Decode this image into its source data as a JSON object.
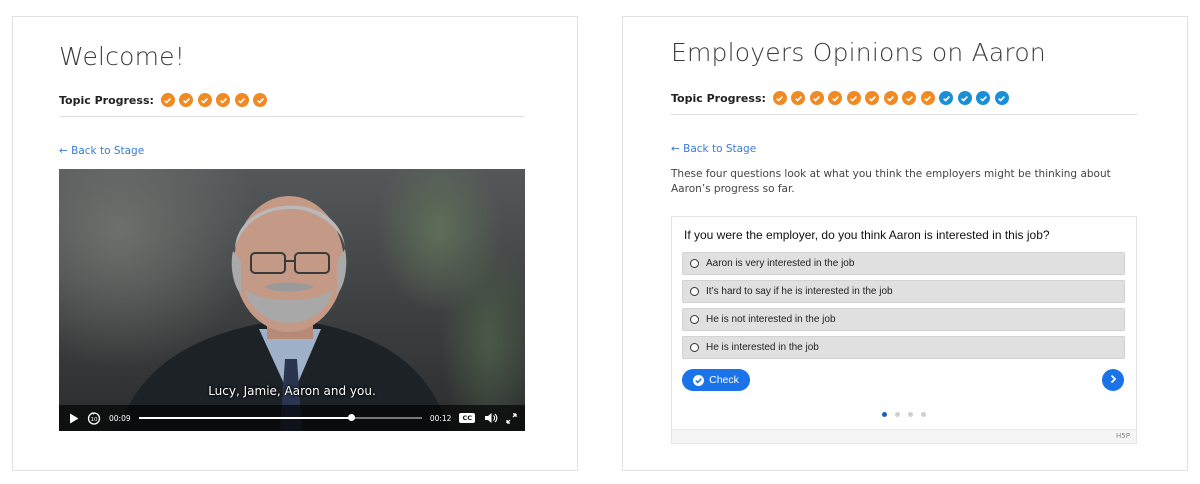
{
  "left_card": {
    "title": "Welcome!",
    "progress_label": "Topic Progress:",
    "progress_items": [
      "complete",
      "complete",
      "complete",
      "complete",
      "complete",
      "complete"
    ],
    "back_link": "← Back to Stage",
    "video": {
      "caption": "Lucy, Jamie, Aaron and you.",
      "current_time": "00:09",
      "duration": "00:12",
      "cc_label": "CC",
      "progress": 0.75
    }
  },
  "right_card": {
    "title": "Employers Opinions on Aaron",
    "progress_label": "Topic Progress:",
    "progress_items": [
      "complete",
      "complete",
      "complete",
      "complete",
      "complete",
      "complete",
      "complete",
      "complete",
      "complete",
      "incomplete",
      "incomplete",
      "incomplete",
      "incomplete"
    ],
    "back_link": "← Back to Stage",
    "intro": "These four questions look at what you think the employers might be thinking about Aaron’s progress so far.",
    "quiz": {
      "question": "If you were the employer, do you think Aaron is interested in this job?",
      "options": [
        "Aaron is very interested in the job",
        "It’s hard to say if he is interested in the job",
        "He is not interested in the job",
        "He is interested in the job"
      ],
      "check_label": "Check",
      "pages": 4,
      "active_page": 1,
      "brand": "H5P"
    }
  },
  "colors": {
    "complete": "#f08a24",
    "incomplete": "#1a8fd6",
    "link": "#3a7bd5",
    "primary_button": "#1a73e8"
  },
  "icons": {
    "progress_item": "checkmark-circle-icon",
    "play": "play-icon",
    "rewind": "rewind-10-icon",
    "volume": "volume-icon",
    "fullscreen": "fullscreen-icon",
    "check": "check-circle-icon",
    "next": "chevron-right-icon"
  }
}
